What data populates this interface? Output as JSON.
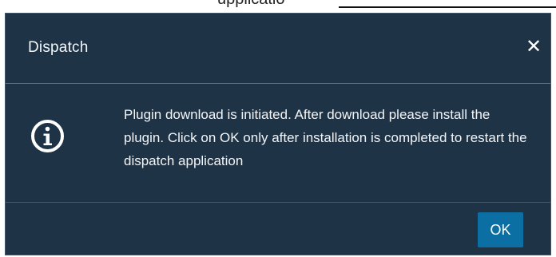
{
  "window": {
    "background_text": "upplicatio"
  },
  "dialog": {
    "title": "Dispatch",
    "close_icon": "close-icon",
    "message": "Plugin download is initiated. After download please install the plugin. Click on OK only after installation is completed to restart the dispatch application",
    "info_icon": "info-icon",
    "ok_label": "OK",
    "colors": {
      "background": "#1f3346",
      "text": "#f2f5f8",
      "ok_button": "#0b6fa4",
      "divider": "#5c7286"
    }
  }
}
